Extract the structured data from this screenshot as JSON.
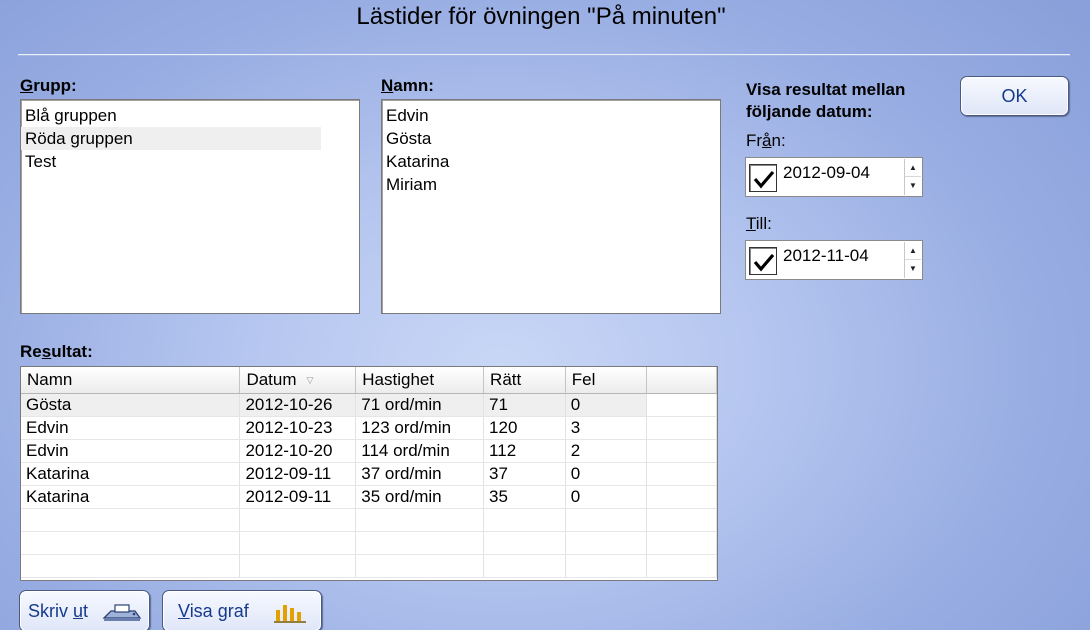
{
  "title": "Lästider för övningen \"På minuten\"",
  "group": {
    "label_first": "G",
    "label_rest": "rupp:",
    "items": [
      {
        "label": "Blå gruppen"
      },
      {
        "label": "Röda gruppen"
      },
      {
        "label": "Test"
      }
    ],
    "selected_index": 1
  },
  "names": {
    "label_first": "N",
    "label_rest": "amn:",
    "items": [
      {
        "label": "Edvin"
      },
      {
        "label": "Gösta"
      },
      {
        "label": "Katarina"
      },
      {
        "label": "Miriam"
      }
    ]
  },
  "date_filter": {
    "heading_line1": "Visa resultat mellan",
    "heading_line2": "följande datum:",
    "from_label_a": "Fr",
    "from_label_u": "å",
    "from_label_b": "n:",
    "from_value": "2012-09-04",
    "from_checked": true,
    "to_label_u": "T",
    "to_label_b": "ill:",
    "to_value": "2012-11-04",
    "to_checked": true
  },
  "ok_label": "OK",
  "results": {
    "label_a": "Re",
    "label_u": "s",
    "label_b": "ultat:",
    "columns": [
      "Namn",
      "Datum",
      "Hastighet",
      "Rätt",
      "Fel"
    ],
    "rows": [
      {
        "name": "Gösta",
        "date": "2012-10-26",
        "speed": "71 ord/min",
        "right": "71",
        "wrong": "0"
      },
      {
        "name": "Edvin",
        "date": "2012-10-23",
        "speed": "123 ord/min",
        "right": "120",
        "wrong": "3"
      },
      {
        "name": "Edvin",
        "date": "2012-10-20",
        "speed": "114 ord/min",
        "right": "112",
        "wrong": "2"
      },
      {
        "name": "Katarina",
        "date": "2012-09-11",
        "speed": "37 ord/min",
        "right": "37",
        "wrong": "0"
      },
      {
        "name": "Katarina",
        "date": "2012-09-11",
        "speed": "35 ord/min",
        "right": "35",
        "wrong": "0"
      }
    ]
  },
  "print_button": {
    "label_a": "Skriv ",
    "label_u": "u",
    "label_b": "t"
  },
  "graph_button": {
    "label_u": "V",
    "label_b": "isa graf"
  },
  "colors": {
    "accent_text": "#163a8c",
    "background": "#b4c5ef"
  }
}
